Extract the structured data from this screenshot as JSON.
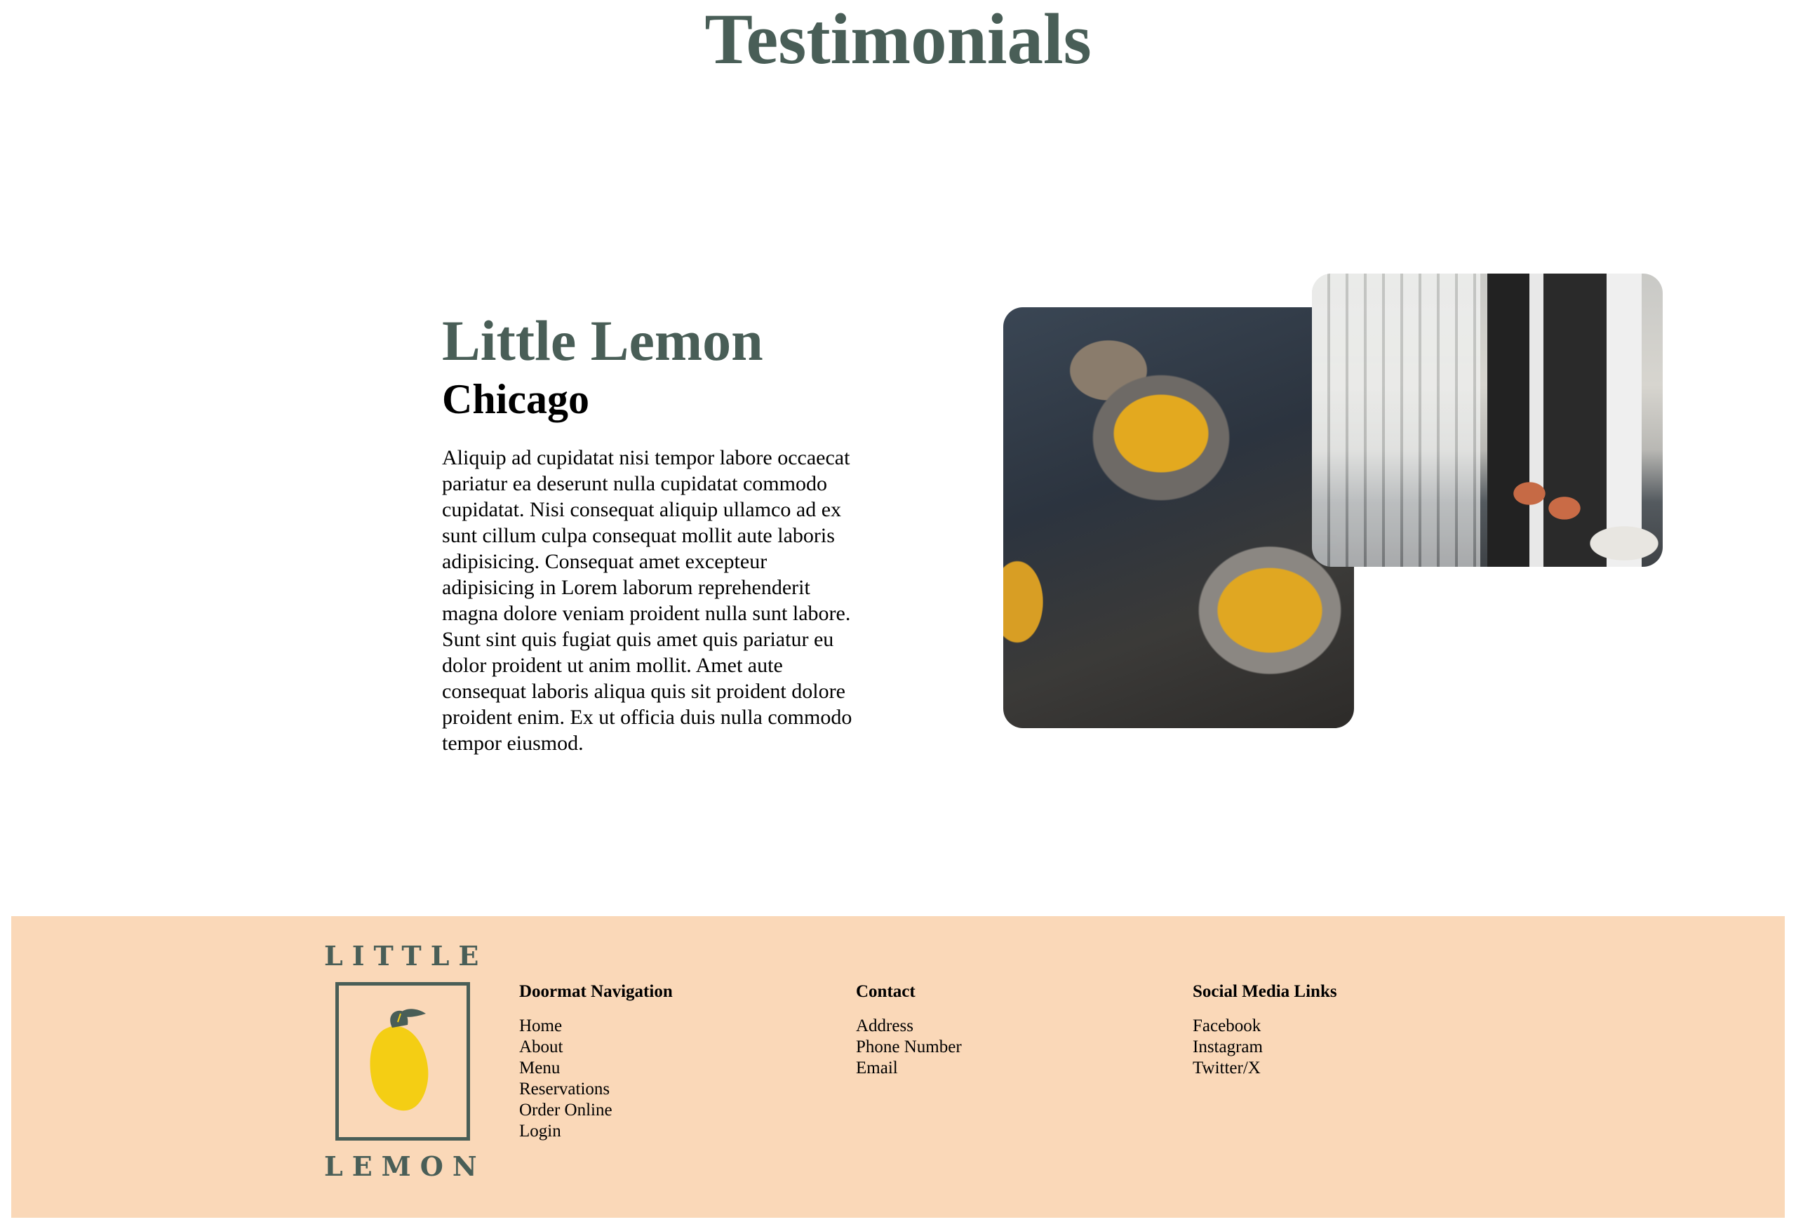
{
  "page": {
    "heading": "Testimonials"
  },
  "about": {
    "title": "Little Lemon",
    "subtitle": "Chicago",
    "paragraph": "Aliquip ad cupidatat nisi tempor labore occaecat pariatur ea deserunt nulla cupidatat commodo cupidatat. Nisi consequat aliquip ullamco ad ex sunt cillum culpa consequat mollit aute laboris adipisicing. Consequat amet excepteur adipisicing in Lorem laborum reprehenderit magna dolore veniam proident nulla sunt labore. Sunt sint quis fugiat quis amet quis pariatur eu dolor proident ut anim mollit. Amet aute consequat laboris aliqua quis sit proident dolore proident enim. Ex ut officia duis nulla commodo tempor eiusmod."
  },
  "footer": {
    "logo": {
      "top_word": "LITTLE",
      "bottom_word": "LEMON"
    },
    "navigation": {
      "heading": "Doormat Navigation",
      "items": [
        "Home",
        "About",
        "Menu",
        "Reservations",
        "Order Online",
        "Login"
      ]
    },
    "contact": {
      "heading": "Contact",
      "items": [
        "Address",
        "Phone Number",
        "Email"
      ]
    },
    "social": {
      "heading": "Social Media Links",
      "items": [
        "Facebook",
        "Instagram",
        "Twitter/X"
      ]
    }
  },
  "colors": {
    "primary_green": "#495e57",
    "footer_background": "#fad8b8",
    "lemon_yellow": "#f4ce14"
  },
  "icons": {
    "logo": "lemon-logo-icon"
  }
}
